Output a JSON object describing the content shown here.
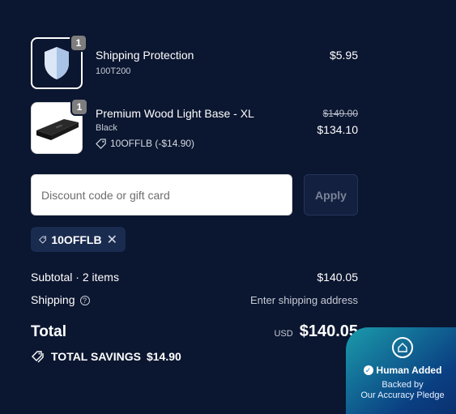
{
  "cart": {
    "items": [
      {
        "name": "Shipping Protection",
        "variant": "100T200",
        "quantity": "1",
        "price": "$5.95",
        "image_icon": "shield-icon"
      },
      {
        "name": "Premium Wood Light Base - XL",
        "variant": "Black",
        "quantity": "1",
        "original_price": "$149.00",
        "price": "$134.10",
        "discount_line": "10OFFLB (-$14.90)",
        "image_icon": "light-base-image"
      }
    ]
  },
  "discount": {
    "placeholder": "Discount code or gift card",
    "value": "",
    "apply_label": "Apply",
    "applied_code": "10OFFLB"
  },
  "summary": {
    "subtotal_label": "Subtotal · 2 items",
    "subtotal_value": "$140.05",
    "shipping_label": "Shipping",
    "shipping_value": "Enter shipping address",
    "total_label": "Total",
    "currency": "USD",
    "total_value": "$140.05",
    "savings_label": "TOTAL SAVINGS",
    "savings_value": "$14.90"
  },
  "badge": {
    "title": "Human Added",
    "subtitle_line1": "Backed by",
    "subtitle_line2": "Our Accuracy Pledge"
  }
}
